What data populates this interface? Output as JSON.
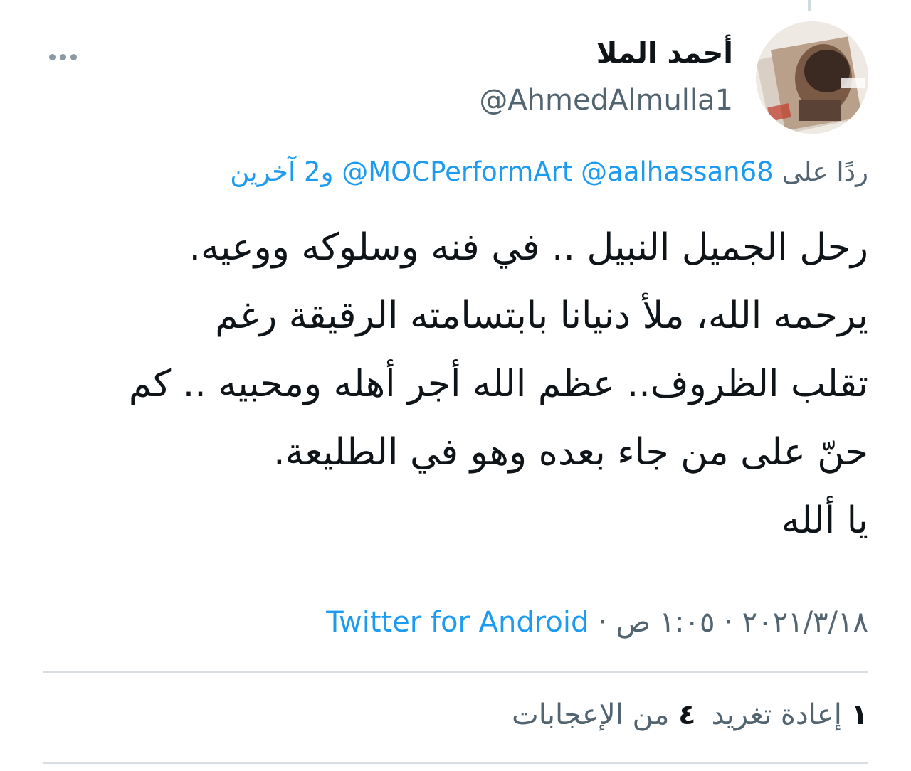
{
  "user": {
    "display_name": "أحمد الملا",
    "handle": "@AhmedAlmulla1",
    "avatar_icon": "profile-photo"
  },
  "reply": {
    "prefix": "ردًا على",
    "mention_1": "@aalhassan68",
    "mention_2": "@MOCPerformArt",
    "others": "و2 آخرين"
  },
  "tweet": {
    "lines": [
      "رحل الجميل النبيل .. في فنه وسلوكه ووعيه.",
      "يرحمه الله، ملأ دنيانا بابتسامته الرقيقة رغم",
      "تقلب الظروف.. عظم الله أجر أهله ومحبيه .. كم",
      "حنّ على من جاء بعده وهو في الطليعة.",
      "يا ألله"
    ]
  },
  "meta": {
    "date": "٢٠٢١/٣/١٨",
    "separator": " · ",
    "time": "١:٠٥ ص",
    "client": "Twitter for Android"
  },
  "stats": {
    "retweets_count": "١",
    "retweets_label": "إعادة تغريد",
    "likes_count": "٤",
    "likes_label": "من الإعجابات"
  },
  "colors": {
    "link": "#1d9bf0",
    "secondary_text": "#536471",
    "primary_text": "#0f1419",
    "divider": "#d9dee2"
  }
}
